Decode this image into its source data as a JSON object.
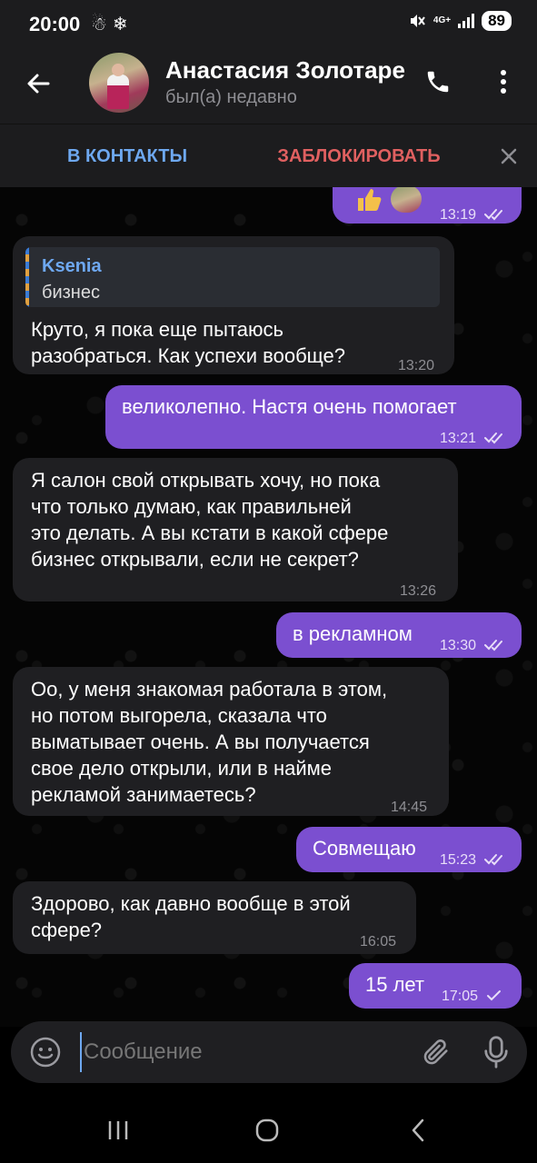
{
  "status_bar": {
    "time": "20:00",
    "left_icons": "☃❄",
    "network": "4G+",
    "battery": "89"
  },
  "header": {
    "name": "Анастасия Золотаре",
    "status": "был(а) недавно",
    "back_icon": "arrow-left",
    "call_icon": "phone",
    "more_icon": "dots-vertical"
  },
  "actions": {
    "add_contact": "В КОНТАКТЫ",
    "block": "ЗАБЛОКИРОВАТЬ"
  },
  "messages": [
    {
      "dir": "out",
      "text": "",
      "time": "13:19",
      "read": true
    },
    {
      "dir": "in",
      "quote_author": "Ksenia",
      "quote_text": "бизнес",
      "lines": [
        "Круто, я пока еще пытаюсь",
        "разобраться. Как успехи вообще?"
      ],
      "time": "13:20"
    },
    {
      "dir": "out",
      "text": "великолепно. Настя очень помогает",
      "time": "13:21",
      "read": true
    },
    {
      "dir": "in",
      "lines": [
        "Я салон свой открывать хочу, но пока",
        "что только думаю, как правильней",
        "это делать. А вы кстати в какой сфере",
        "бизнес открывали, если не секрет?"
      ],
      "time": "13:26"
    },
    {
      "dir": "out",
      "text": "в рекламном",
      "time": "13:30",
      "read": true
    },
    {
      "dir": "in",
      "lines": [
        "Оо, у меня знакомая работала в этом,",
        "но потом выгорела, сказала что",
        "выматывает очень. А вы получается",
        "свое дело открыли, или в найме",
        "рекламой занимаетесь?"
      ],
      "time": "14:45"
    },
    {
      "dir": "out",
      "text": "Совмещаю",
      "time": "15:23",
      "read": true
    },
    {
      "dir": "in",
      "lines": [
        "Здорово, как давно вообще в этой",
        "сфере?"
      ],
      "time": "16:05"
    },
    {
      "dir": "out",
      "text": "15 лет",
      "time": "17:05",
      "read": false
    }
  ],
  "input": {
    "placeholder": "Сообщение"
  },
  "colors": {
    "incoming_bubble": "#1f1f22",
    "outgoing_bubble": "#7b4fd0",
    "accent_blue": "#6ea8f0",
    "danger_red": "#e06060"
  }
}
